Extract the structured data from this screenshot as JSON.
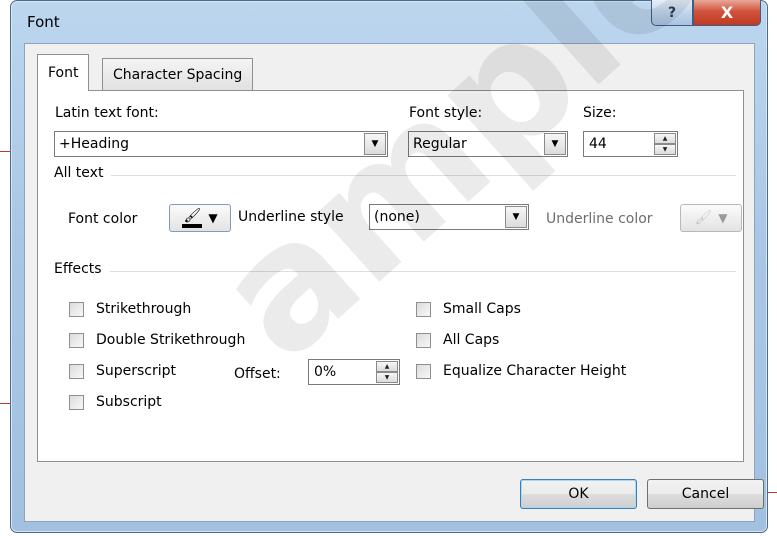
{
  "window": {
    "title": "Font",
    "help_glyph": "?",
    "close_glyph": "X"
  },
  "tabs": [
    {
      "label": "Font",
      "selected": true
    },
    {
      "label": "Character Spacing",
      "selected": false
    }
  ],
  "fields": {
    "latin_text_font_label": "Latin text font:",
    "latin_text_font_value": "+Heading",
    "font_style_label": "Font style:",
    "font_style_value": "Regular",
    "size_label": "Size:",
    "size_value": "44"
  },
  "all_text": {
    "group_title": "All text",
    "font_color_label": "Font color",
    "underline_style_label": "Underline style",
    "underline_style_value": "(none)",
    "underline_color_label": "Underline color"
  },
  "effects": {
    "group_title": "Effects",
    "left": [
      {
        "label": "Strikethrough",
        "checked": false
      },
      {
        "label": "Double Strikethrough",
        "checked": false
      },
      {
        "label": "Superscript",
        "checked": false
      },
      {
        "label": "Subscript",
        "checked": false
      }
    ],
    "right": [
      {
        "label": "Small Caps",
        "checked": false
      },
      {
        "label": "All Caps",
        "checked": false
      },
      {
        "label": "Equalize Character Height",
        "checked": false
      }
    ],
    "offset_label": "Offset:",
    "offset_value": "0%"
  },
  "buttons": {
    "ok": "OK",
    "cancel": "Cancel"
  },
  "watermark": "ample",
  "icons": {
    "dropdown": "▼",
    "spin_up": "▲",
    "spin_down": "▼",
    "fill_bucket": "🖌"
  },
  "colors": {
    "accent": "#3c7fb1",
    "close": "#c03a22",
    "callout": "#c0392b"
  }
}
